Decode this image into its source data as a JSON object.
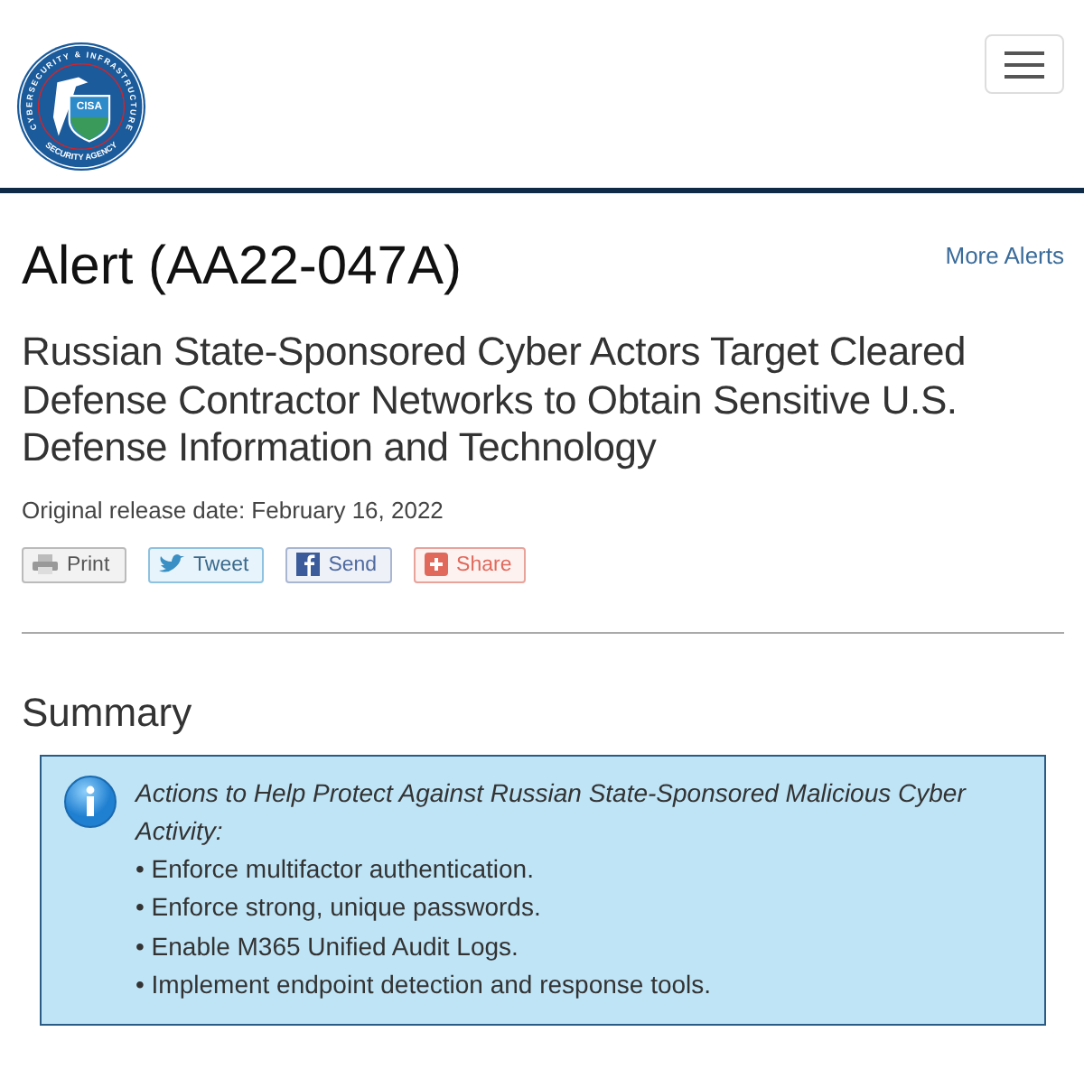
{
  "header": {
    "logo": {
      "ring_top": "CYBERSECURITY & INFRASTRUCTURE",
      "ring_bottom": "SECURITY AGENCY",
      "badge": "CISA"
    }
  },
  "alert": {
    "title": "Alert (AA22-047A)",
    "more_link": "More Alerts",
    "subtitle": "Russian State-Sponsored Cyber Actors Target Cleared Defense Contractor Networks to Obtain Sensitive U.S. Defense Information and Technology",
    "release_date": "Original release date: February 16, 2022"
  },
  "share_buttons": [
    {
      "kind": "print",
      "label": "Print"
    },
    {
      "kind": "tweet",
      "label": "Tweet"
    },
    {
      "kind": "send",
      "label": "Send"
    },
    {
      "kind": "share",
      "label": "Share"
    }
  ],
  "summary": {
    "heading": "Summary",
    "callout": {
      "title": "Actions to Help Protect Against Russian State-Sponsored Malicious Cyber Activity:",
      "items": [
        "• Enforce multifactor authentication.",
        "• Enforce strong, unique passwords.",
        "• Enable M365 Unified Audit Logs.",
        "• Implement endpoint detection and response tools."
      ]
    }
  }
}
